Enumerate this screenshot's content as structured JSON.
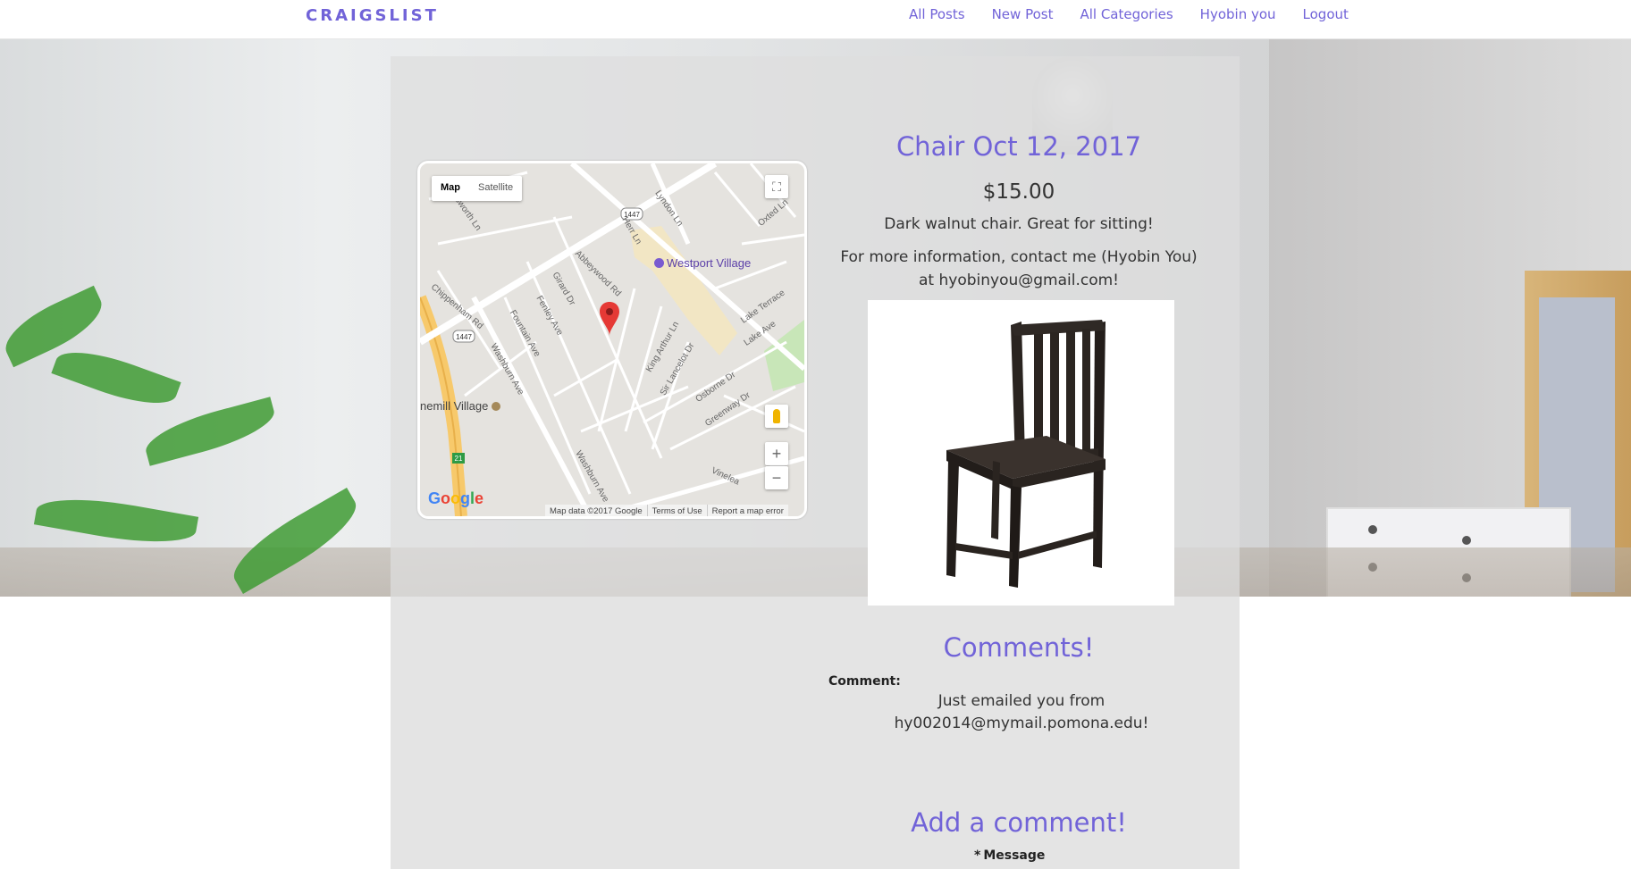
{
  "navbar": {
    "brand": "CRAIGSLIST",
    "links": [
      "All Posts",
      "New Post",
      "All Categories",
      "Hyobin you",
      "Logout"
    ]
  },
  "map": {
    "type_map": "Map",
    "type_satellite": "Satellite",
    "poi_westport": "Westport Village",
    "poi_stonemill": "nemill Village",
    "footer_data": "Map data ©2017 Google",
    "footer_terms": "Terms of Use",
    "footer_report": "Report a map error",
    "logo": "Google",
    "streets": [
      "Lyndon Ln",
      "Herr Ln",
      "Abbeywood Rd",
      "Girard Dr",
      "Fenley Ave",
      "Fountain Ave",
      "Washburn Ave",
      "Chippenham Rd",
      "Holsworth Ln",
      "King Arthur Ln",
      "Sir Lancelot Dr",
      "Osborne Dr",
      "Greenway Dr",
      "Lake Ave",
      "Lake Terrace",
      "Oxted Ln",
      "Vinelea",
      "Washburn Ave"
    ],
    "route_badges": [
      "1447",
      "1447",
      "21"
    ],
    "icons": [
      "fullscreen-icon",
      "pegman-icon",
      "zoom-in-icon",
      "zoom-out-icon",
      "map-pin-icon"
    ]
  },
  "post": {
    "title": "Chair Oct 12, 2017",
    "price": "$15.00",
    "description": "Dark walnut chair. Great for sitting!",
    "contact_line1": "For more information, contact me (Hyobin You)",
    "contact_line2": "at hyobinyou@gmail.com!"
  },
  "comments": {
    "heading": "Comments!",
    "label": "Comment:",
    "text_line1": "Just emailed you from",
    "text_line2": "hy002014@mymail.pomona.edu!"
  },
  "add_comment": {
    "heading": "Add a comment!",
    "required_mark": "*",
    "message_label": "Message"
  },
  "colors": {
    "accent": "#7163d8",
    "panel": "#dedede"
  }
}
